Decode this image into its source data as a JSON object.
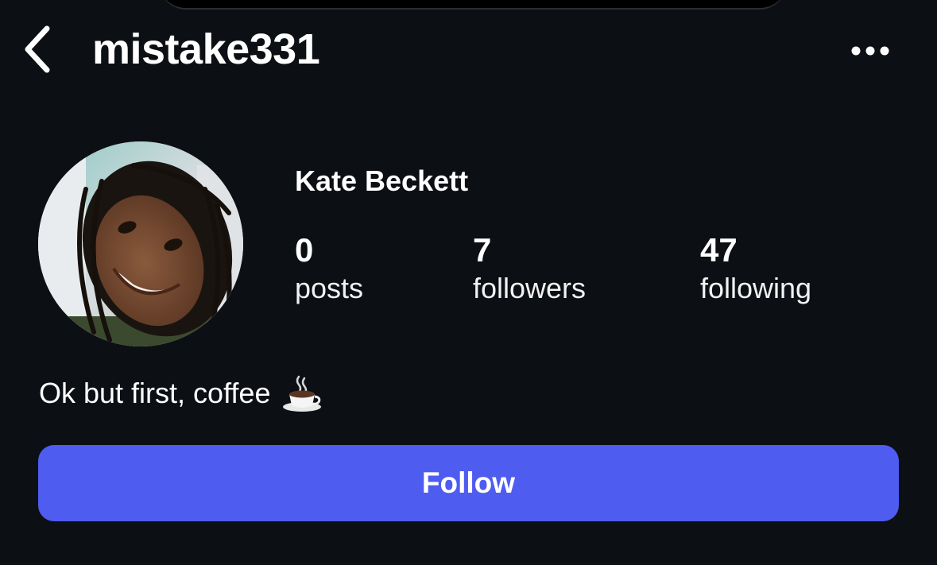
{
  "header": {
    "username": "mistake331",
    "back_icon": "chevron-left-icon",
    "more_icon": "ellipsis-horizontal-icon"
  },
  "profile": {
    "display_name": "Kate Beckett",
    "avatar_icon": "profile-photo",
    "stats": [
      {
        "count": "0",
        "label": "posts"
      },
      {
        "count": "7",
        "label": "followers"
      },
      {
        "count": "47",
        "label": "following"
      }
    ],
    "bio": "Ok but first, coffee",
    "bio_emoji": "coffee-cup-icon"
  },
  "actions": {
    "follow_label": "Follow"
  },
  "colors": {
    "background": "#0c0f14",
    "text": "#ffffff",
    "follow_button": "#4f5cf0"
  }
}
